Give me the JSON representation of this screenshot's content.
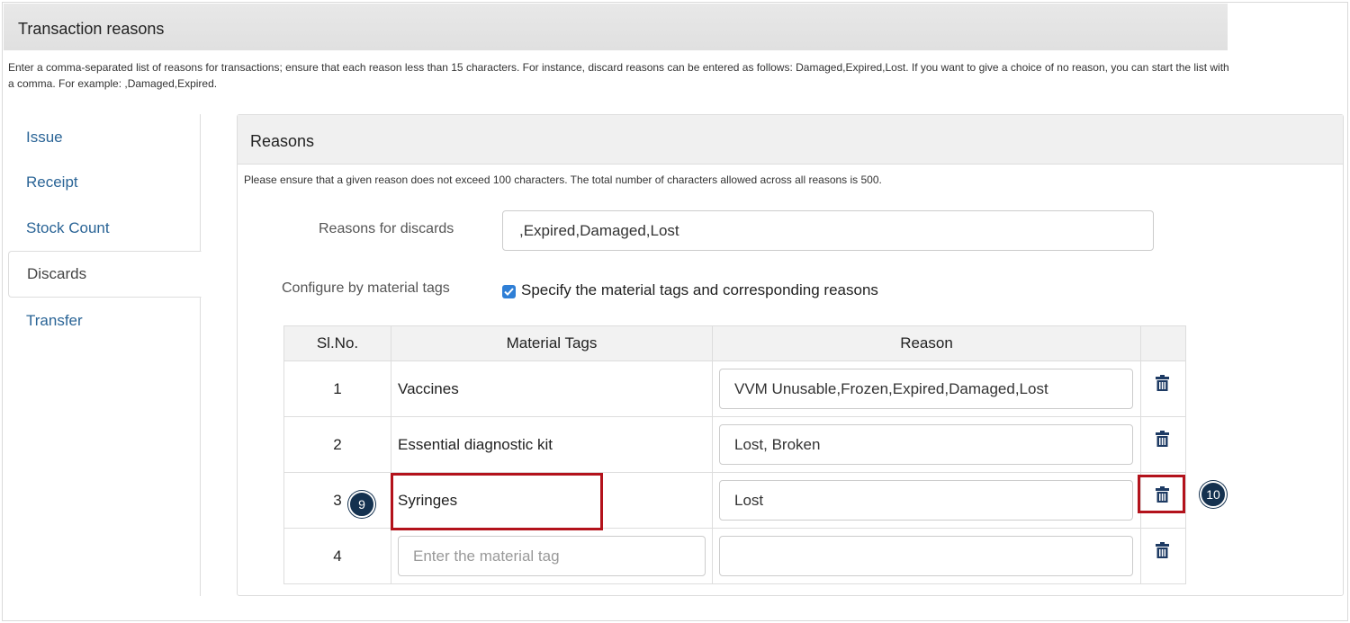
{
  "header": {
    "title": "Transaction reasons"
  },
  "description": "Enter a comma-separated list of reasons for transactions; ensure that each reason less than 15 characters. For instance, discard reasons can be entered as follows: Damaged,Expired,Lost. If you want to give a choice of no reason, you can start the list with a comma. For example: ,Damaged,Expired.",
  "nav": {
    "items": [
      {
        "label": "Issue"
      },
      {
        "label": "Receipt"
      },
      {
        "label": "Stock Count"
      },
      {
        "label": "Discards",
        "active": true
      },
      {
        "label": "Transfer"
      }
    ]
  },
  "panel": {
    "title": "Reasons",
    "description": "Please ensure that a given reason does not exceed 100 characters. The total number of characters allowed across all reasons is 500.",
    "discards_label": "Reasons for discards",
    "discards_value": ",Expired,Damaged,Lost",
    "configure_label": "Configure by material tags",
    "checkbox_label": "Specify the material tags and corresponding reasons",
    "checkbox_checked": true
  },
  "table": {
    "headers": [
      "Sl.No.",
      "Material Tags",
      "Reason",
      ""
    ],
    "rows": [
      {
        "slno": "1",
        "tag": "Vaccines",
        "reason": "VVM Unusable,Frozen,Expired,Damaged,Lost"
      },
      {
        "slno": "2",
        "tag": "Essential diagnostic kit",
        "reason": "Lost, Broken"
      },
      {
        "slno": "3",
        "tag": "Syringes",
        "reason": "Lost"
      },
      {
        "slno": "4",
        "tag_placeholder": "Enter the material tag",
        "reason": ""
      }
    ]
  },
  "callouts": {
    "first": "9",
    "second": "10"
  },
  "colors": {
    "accent": "#2f7fd6",
    "highlight": "#b3121b",
    "callout": "#14314f",
    "link": "#2a6496"
  },
  "icons": {
    "delete": "trash-icon"
  }
}
